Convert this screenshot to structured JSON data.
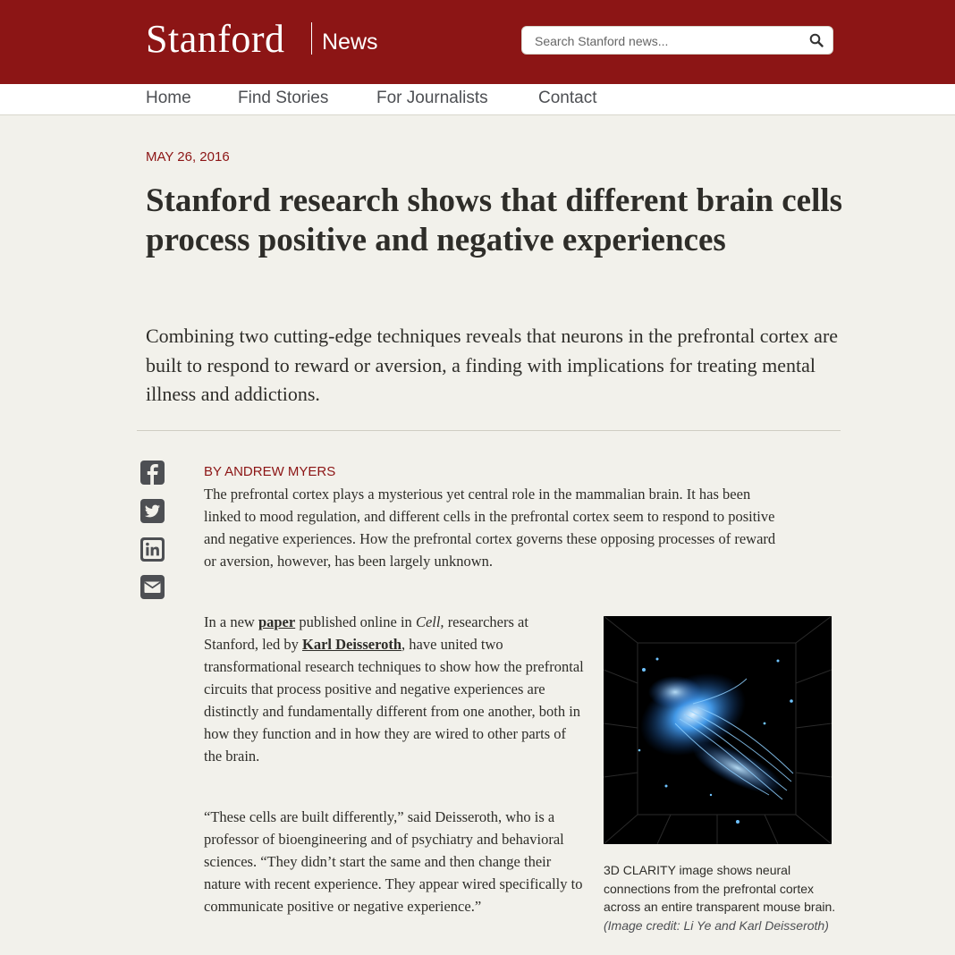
{
  "header": {
    "brand": "Stanford",
    "section": "News",
    "search_placeholder": "Search Stanford news...",
    "colors": {
      "brand_red": "#8c1515",
      "background": "#f2f1eb"
    }
  },
  "nav": [
    {
      "label": "Home"
    },
    {
      "label": "Find Stories"
    },
    {
      "label": "For Journalists"
    },
    {
      "label": "Contact"
    }
  ],
  "article": {
    "date": "MAY 26, 2016",
    "title": "Stanford research shows that different brain cells process positive and negative experiences",
    "dek": "Combining two cutting-edge techniques reveals that neurons in the prefrontal cortex are built to respond to reward or aversion, a finding with implications for treating mental illness and addictions.",
    "share_icons": [
      "facebook-icon",
      "twitter-icon",
      "linkedin-icon",
      "email-icon"
    ],
    "byline": "BY ANDREW MYERS",
    "p1": "The prefrontal cortex plays a mysterious yet central role in the mammalian brain. It has been linked to mood regulation, and different cells in the prefrontal cortex seem to respond to positive and negative experiences. How the prefrontal cortex governs these opposing processes of reward or aversion, however, has been largely unknown.",
    "p2": {
      "a": "In a new ",
      "link1": "paper",
      "b": " published online in ",
      "journal": "Cell,",
      "c": " researchers at Stanford, led by ",
      "link2": "Karl Deisseroth",
      "d": ", have united two transformational research techniques to show how the prefrontal circuits that process positive and negative experiences are distinctly and fundamentally different from one another, both in how they function and in how they are wired to other parts of the brain."
    },
    "p3": "“These cells are built differently,” said Deisseroth, who is a professor of bioengineering and of psychiatry and behavioral sciences. “They didn’t start the same and then change their nature with recent experience. They appear wired specifically to communicate positive or negative experience.”",
    "caption": {
      "text": "3D CLARITY image shows neural connections from the prefrontal cortex across an entire transparent mouse brain. ",
      "credit": "(Image credit: Li Ye and Karl Deisseroth)"
    }
  }
}
